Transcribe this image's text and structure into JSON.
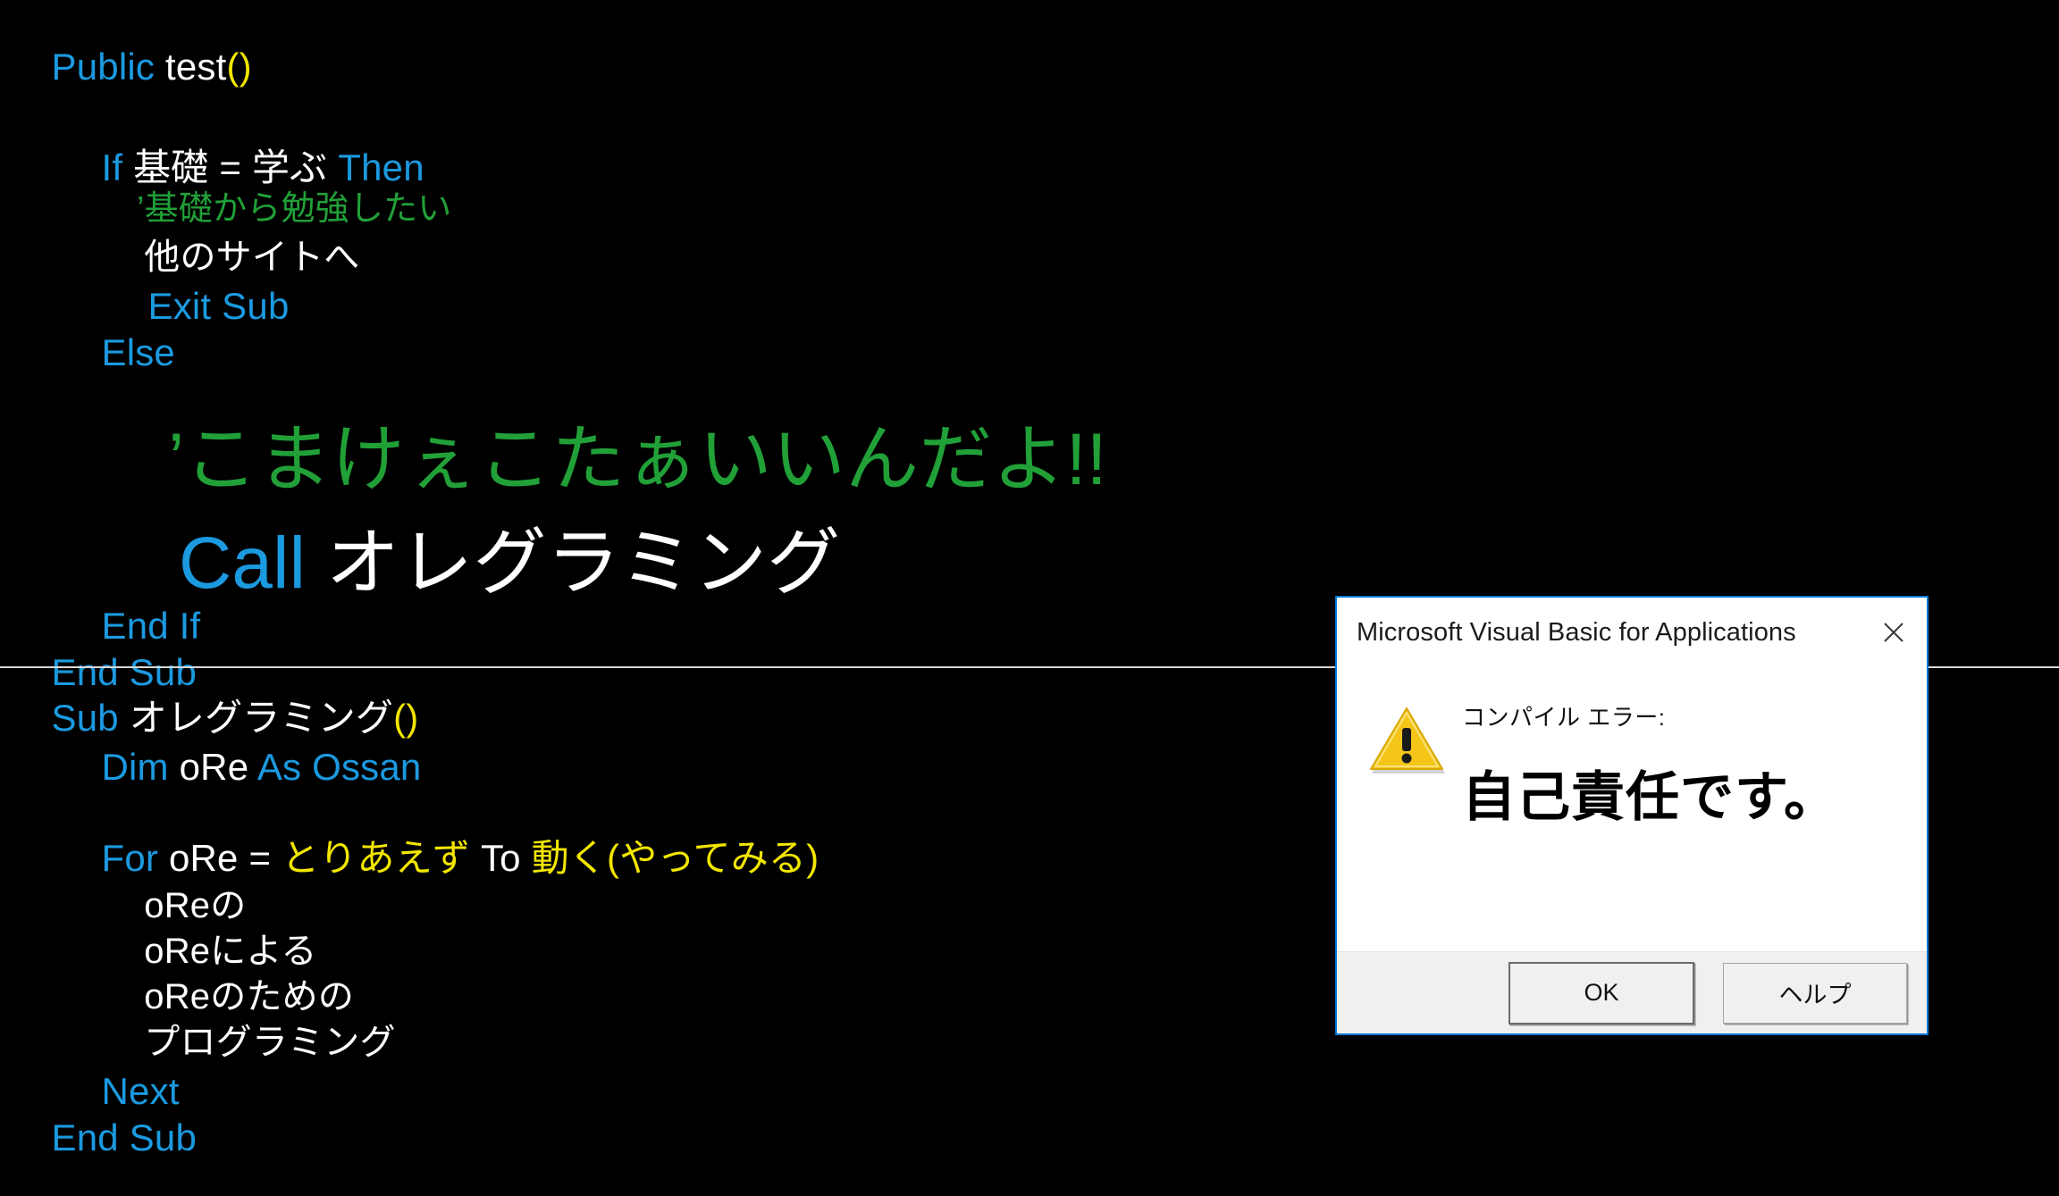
{
  "editor": {
    "background": "#000000",
    "colors": {
      "keyword": "#1b9ae0",
      "comment": "#21a038",
      "string": "#ffffff",
      "yellow": "#f2e600",
      "text": "#ffffff",
      "divider": "#d8d8d8"
    },
    "lines": [
      {
        "id": "l1",
        "parts": [
          {
            "t": "Public ",
            "c": "kw"
          },
          {
            "t": "test",
            "c": "wht"
          },
          {
            "t": "()",
            "c": "yel"
          }
        ]
      },
      {
        "id": "l2",
        "parts": [
          {
            "t": "If ",
            "c": "kw"
          },
          {
            "t": "基礎 = 学ぶ ",
            "c": "wht"
          },
          {
            "t": "Then",
            "c": "kw"
          }
        ]
      },
      {
        "id": "l3",
        "parts": [
          {
            "t": "’基礎から勉強したい",
            "c": "cmt"
          }
        ]
      },
      {
        "id": "l4",
        "parts": [
          {
            "t": "他のサイトへ",
            "c": "wht"
          }
        ]
      },
      {
        "id": "l5",
        "parts": [
          {
            "t": "Exit Sub",
            "c": "kw"
          }
        ]
      },
      {
        "id": "l6",
        "parts": [
          {
            "t": "Else",
            "c": "kw"
          }
        ]
      },
      {
        "id": "l7",
        "parts": [
          {
            "t": "’こまけぇこたぁいいんだよ!!",
            "c": "cmt"
          }
        ]
      },
      {
        "id": "l8",
        "parts": [
          {
            "t": "Call ",
            "c": "kw"
          },
          {
            "t": "オレグラミング",
            "c": "wht"
          }
        ]
      },
      {
        "id": "l9",
        "parts": [
          {
            "t": "End If",
            "c": "kw"
          }
        ]
      },
      {
        "id": "l10",
        "parts": [
          {
            "t": "End Sub",
            "c": "kw"
          }
        ]
      },
      {
        "id": "l11",
        "parts": [
          {
            "t": "Sub ",
            "c": "kw"
          },
          {
            "t": "オレグラミング",
            "c": "wht"
          },
          {
            "t": "()",
            "c": "yel"
          }
        ]
      },
      {
        "id": "l12",
        "parts": [
          {
            "t": "Dim ",
            "c": "kw"
          },
          {
            "t": "oRe ",
            "c": "wht"
          },
          {
            "t": "As Ossan",
            "c": "kw"
          }
        ]
      },
      {
        "id": "l13",
        "parts": [
          {
            "t": "For ",
            "c": "kw"
          },
          {
            "t": "oRe = ",
            "c": "wht"
          },
          {
            "t": "とりあえず ",
            "c": "yel"
          },
          {
            "t": "To ",
            "c": "wht"
          },
          {
            "t": "動く(やってみる)",
            "c": "yel"
          }
        ]
      },
      {
        "id": "l14",
        "parts": [
          {
            "t": "oReの",
            "c": "wht"
          }
        ]
      },
      {
        "id": "l15",
        "parts": [
          {
            "t": "oReによる",
            "c": "wht"
          }
        ]
      },
      {
        "id": "l16",
        "parts": [
          {
            "t": "oReのための",
            "c": "wht"
          }
        ]
      },
      {
        "id": "l17",
        "parts": [
          {
            "t": "プログラミング",
            "c": "wht"
          }
        ]
      },
      {
        "id": "l18",
        "parts": [
          {
            "t": "Next",
            "c": "kw"
          }
        ]
      },
      {
        "id": "l19",
        "parts": [
          {
            "t": "End Sub",
            "c": "kw"
          }
        ]
      }
    ]
  },
  "dialog": {
    "title": "Microsoft Visual Basic for Applications",
    "close_label": "✕",
    "icon": "warning-triangle",
    "subtitle": "コンパイル エラー:",
    "message": "自己責任です。",
    "buttons": [
      {
        "label": "OK",
        "default": true
      },
      {
        "label": "ヘルプ",
        "default": false
      }
    ],
    "accent_color": "#0078d7",
    "footer_color": "#f0f0f0"
  }
}
